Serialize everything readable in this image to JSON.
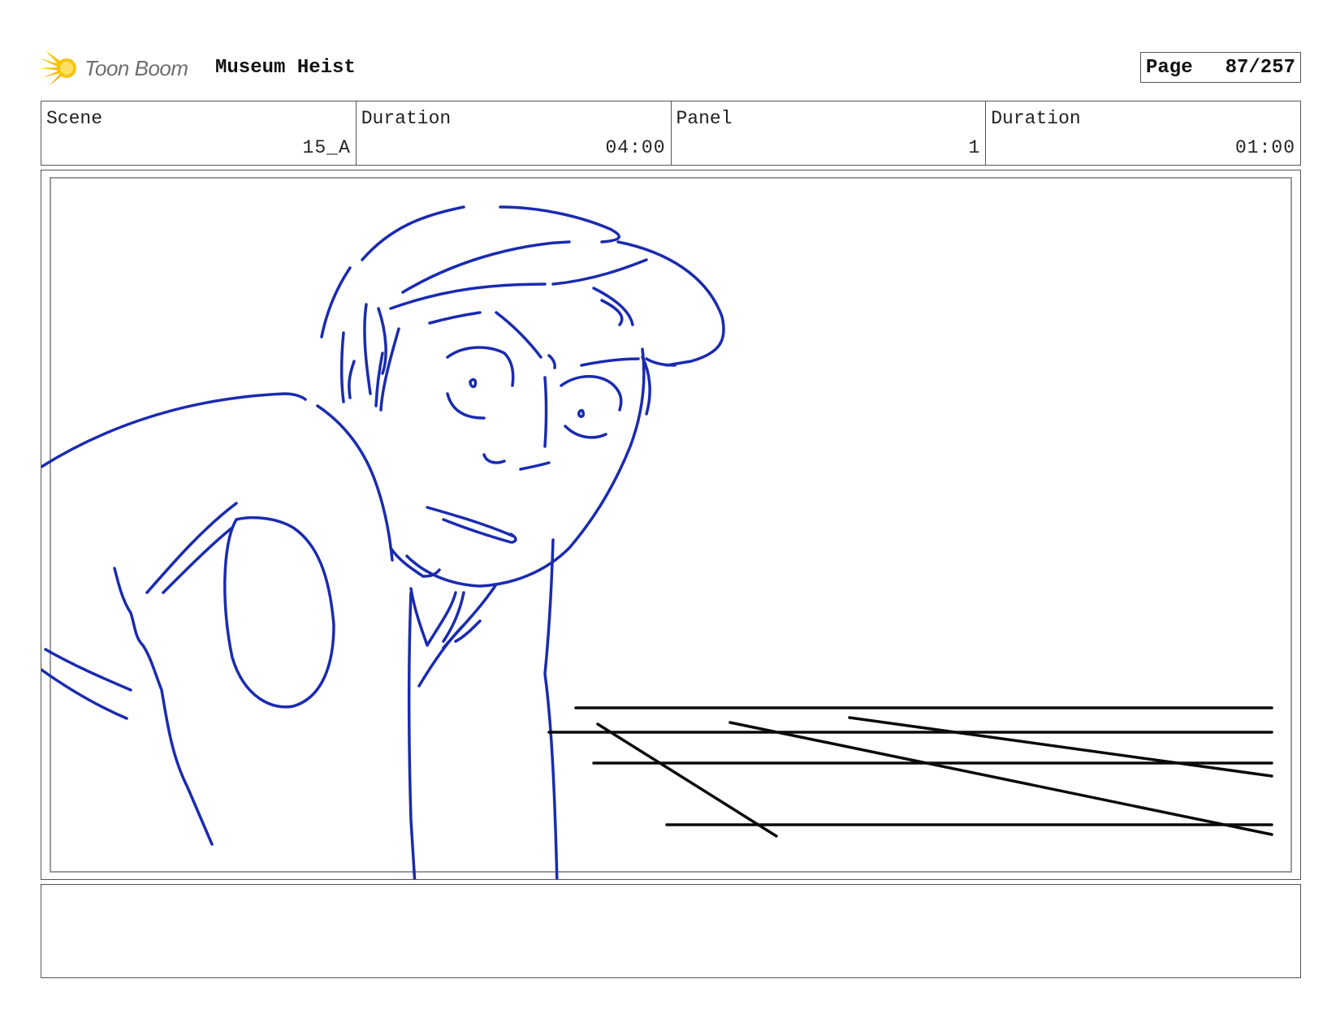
{
  "header": {
    "logo_text": "Toon Boom",
    "project_title": "Museum Heist",
    "page_label": "Page",
    "page_number": "87/257"
  },
  "info": [
    {
      "label": "Scene",
      "value": "15_A"
    },
    {
      "label": "Duration",
      "value": "04:00"
    },
    {
      "label": "Panel",
      "value": "1"
    },
    {
      "label": "Duration",
      "value": "01:00"
    }
  ],
  "notes": {
    "text": ""
  },
  "colors": {
    "sketch_ink": "#1a2bb0",
    "line_ink": "#0a0a0a",
    "logo_yellow": "#f5c400",
    "logo_text": "#6e6e6e"
  }
}
